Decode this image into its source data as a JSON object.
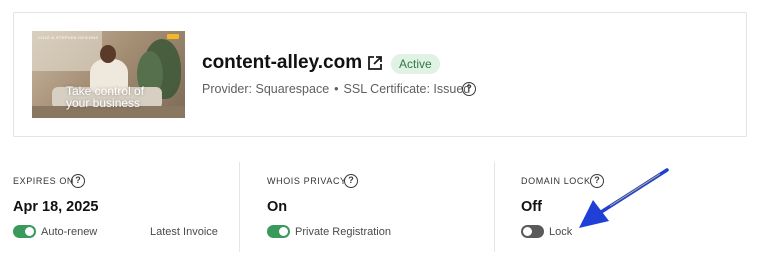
{
  "domain": {
    "name": "content-alley.com",
    "status": "Active",
    "provider_text": "Provider: Squarespace",
    "separator": "•",
    "ssl_text": "SSL Certificate: Issued",
    "thumbnail": {
      "tagline": "Take control of your business",
      "nav_text": "COLE & STEPHEN DESIGNS"
    }
  },
  "panels": [
    {
      "label": "EXPIRES ON",
      "value": "Apr 18, 2025",
      "toggle_label": "Auto-renew",
      "toggle_on": true,
      "link": "Latest Invoice"
    },
    {
      "label": "WHOIS PRIVACY",
      "value": "On",
      "toggle_label": "Private Registration",
      "toggle_on": true
    },
    {
      "label": "DOMAIN LOCK",
      "value": "Off",
      "toggle_label": "Lock",
      "toggle_on": false
    }
  ],
  "help_glyph": "?",
  "colors": {
    "toggle_on": "#3a9a5b",
    "toggle_off": "#5a5a5a",
    "badge_bg": "#dff2e4",
    "badge_text": "#2f7a45",
    "annotation_arrow": "#1f3fd6"
  },
  "icons": [
    "external-link-icon",
    "help-icon",
    "annotation-arrow"
  ]
}
